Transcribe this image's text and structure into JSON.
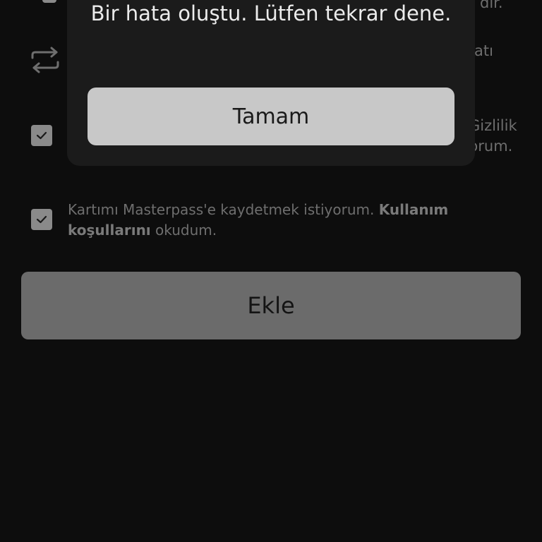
{
  "background": {
    "top_partial_right": "dır.",
    "row2_partial_right": "atı",
    "row3_partial_right_line1": "Gizlilik",
    "row3_partial_right_line2": "yorum.",
    "consent_prefix": "Kartımı Masterpass'e kaydetmek istiyorum. ",
    "consent_bold_1": "Kullanım",
    "consent_bold_2": "koşullarını",
    "consent_suffix": " okudum.",
    "add_button_label": "Ekle"
  },
  "dialog": {
    "message": "Bir hata oluştu. Lütfen tekrar dene.",
    "ok_button_label": "Tamam"
  },
  "colors": {
    "background": "#0d0d0d",
    "dialog": "#1b1b1b",
    "ok_button": "#c8c8c8",
    "add_button": "#6b6b6b",
    "checkbox": "#8a8a8a"
  }
}
